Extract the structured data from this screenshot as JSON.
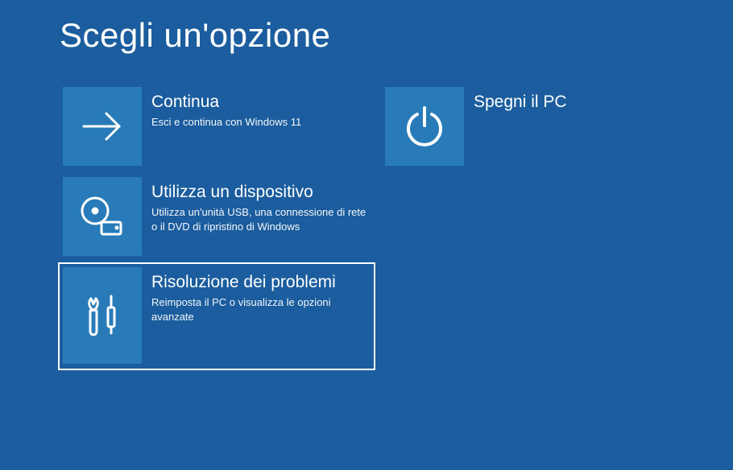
{
  "title": "Scegli un'opzione",
  "tiles": {
    "continue": {
      "title": "Continua",
      "desc": "Esci e continua con Windows 11"
    },
    "shutdown": {
      "title": "Spegni il PC"
    },
    "device": {
      "title": "Utilizza un dispositivo",
      "desc": "Utilizza un'unità USB, una connessione di rete o il DVD di ripristino di Windows"
    },
    "troubleshoot": {
      "title": "Risoluzione dei problemi",
      "desc": "Reimposta il PC o visualizza le opzioni avanzate"
    }
  }
}
